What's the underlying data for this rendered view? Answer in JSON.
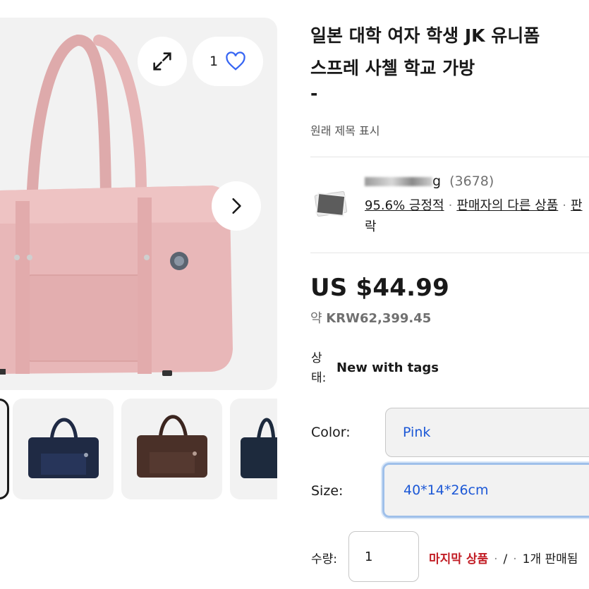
{
  "gallery": {
    "watch_count": "1",
    "icons": {
      "expand": "expand-icon",
      "heart": "heart-icon",
      "next": "chevron-right-icon"
    },
    "thumbnails": [
      {
        "color": "#e8b7b8"
      },
      {
        "color": "#1f2a44"
      },
      {
        "color": "#4a3028"
      },
      {
        "color": "#1d2a3d"
      }
    ]
  },
  "product": {
    "title_line1": "일본 대학 여자 학생 JK 유니폼",
    "title_line2": "스프레 사첼 학교 가방",
    "title_dash": "-",
    "original_title_link": "원래 제목 표시"
  },
  "seller": {
    "name_visible": "g",
    "feedback_count": "(3678)",
    "positive": "95.6% 긍정적",
    "other_items": "판매자의 다른 상품",
    "contact_partial": "판",
    "contact_wrap": "락"
  },
  "pricing": {
    "price": "US $44.99",
    "approx_prefix": "약",
    "approx_value": "KRW62,399.45"
  },
  "condition": {
    "label": "상태:",
    "value": "New with tags"
  },
  "options": {
    "color_label": "Color:",
    "color_value": "Pink",
    "size_label": "Size:",
    "size_value": "40*14*26cm"
  },
  "quantity": {
    "label": "수량:",
    "value": "1",
    "last_item": "마지막 상품",
    "separator": "/",
    "sold_partial": "1개 판매됨"
  },
  "colors": {
    "link_blue": "#1c58d6",
    "alert_red": "#c21e26",
    "bag_pink": "#e8b7b8",
    "heart_blue": "#3665f3"
  }
}
